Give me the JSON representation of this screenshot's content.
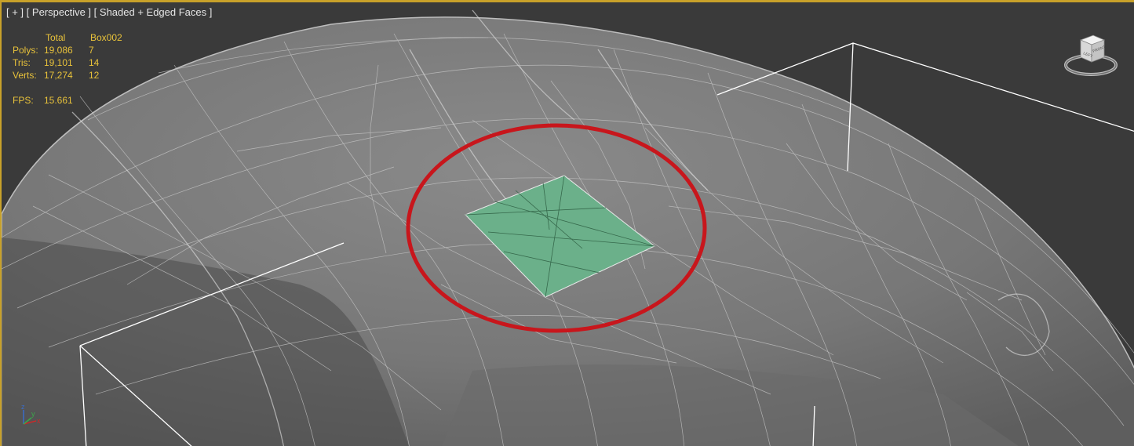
{
  "viewport": {
    "label_plus": "[ + ]",
    "label_view": "[ Perspective ]",
    "label_shading": "[ Shaded + Edged Faces ]"
  },
  "stats": {
    "header_total": "Total",
    "header_object": "Box002",
    "polys_label": "Polys:",
    "polys_total": "19,086",
    "polys_object": "7",
    "tris_label": "Tris:",
    "tris_total": "19,101",
    "tris_object": "14",
    "verts_label": "Verts:",
    "verts_total": "17,274",
    "verts_object": "12",
    "fps_label": "FPS:",
    "fps_value": "15.661"
  },
  "viewcube": {
    "face_left": "LEFT",
    "face_front": "FRONT"
  },
  "axis": {
    "z": "z",
    "x": "x",
    "y": "y"
  },
  "colors": {
    "viewport_border": "#c8a12a",
    "background": "#3a3a3a",
    "stats_text": "#e8c23a",
    "selected_face": "#6bb08a",
    "highlight_circle": "#c8161c"
  }
}
